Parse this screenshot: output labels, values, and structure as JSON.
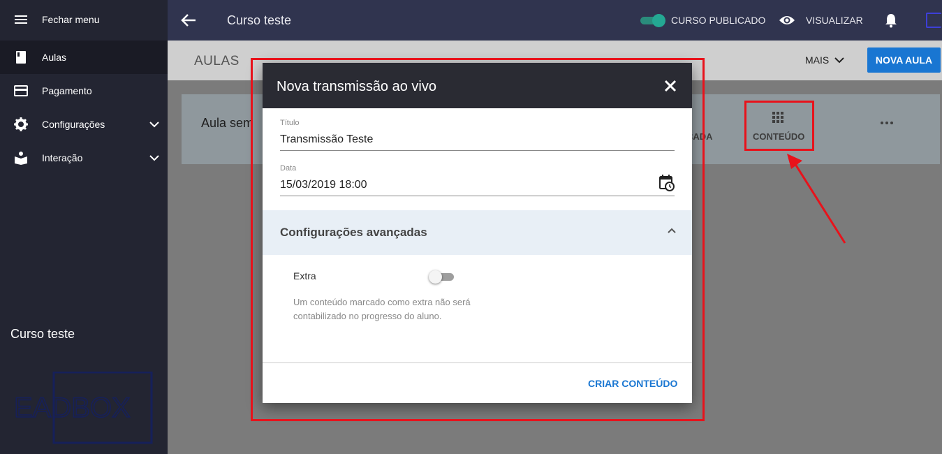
{
  "sidebar": {
    "items": [
      {
        "label": "Fechar menu",
        "icon": "menu-icon"
      },
      {
        "label": "Aulas",
        "icon": "book-icon"
      },
      {
        "label": "Pagamento",
        "icon": "credit-card-icon"
      },
      {
        "label": "Configurações",
        "icon": "gear-icon"
      },
      {
        "label": "Interação",
        "icon": "reader-icon"
      }
    ],
    "course_name": "Curso teste",
    "logo_text": "EADBOX"
  },
  "topbar": {
    "title": "Curso teste",
    "published_label": "CURSO PUBLICADO",
    "view_label": "VISUALIZAR"
  },
  "pagebar": {
    "title": "AULAS",
    "more_label": "MAIS",
    "new_lesson_label": "NOVA AULA"
  },
  "card": {
    "title": "Aula sem",
    "partial_label": "CADA",
    "content_label": "CONTEÚDO"
  },
  "dialog": {
    "title": "Nova transmissão ao vivo",
    "title_field": {
      "label": "Título",
      "value": "Transmissão Teste"
    },
    "date_field": {
      "label": "Data",
      "value": "15/03/2019 18:00"
    },
    "advanced_title": "Configurações avançadas",
    "extra_label": "Extra",
    "extra_help": "Um conteúdo marcado como extra não será contabilizado no progresso do aluno.",
    "action_label": "CRIAR CONTEÚDO"
  },
  "colors": {
    "sidebar_bg": "#232532",
    "topbar_bg": "#30344f",
    "accent_blue": "#1976d2",
    "toggle_green": "#24a893",
    "annotation_red": "#e8121b"
  }
}
